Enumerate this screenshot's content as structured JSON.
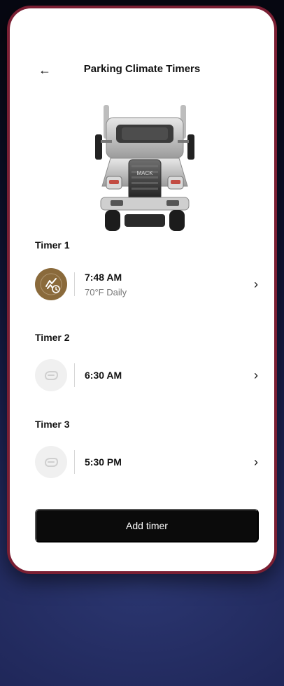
{
  "header": {
    "title": "Parking Climate Timers",
    "back_icon": "←"
  },
  "truck": {
    "brand_text": "MACK"
  },
  "timers": [
    {
      "label": "Timer 1",
      "time": "7:48 AM",
      "sub": "70°F Daily",
      "state": "active"
    },
    {
      "label": "Timer 2",
      "time": "6:30 AM",
      "sub": "",
      "state": "inactive"
    },
    {
      "label": "Timer 3",
      "time": "5:30 PM",
      "sub": "",
      "state": "inactive"
    }
  ],
  "actions": {
    "add_timer_label": "Add timer"
  },
  "colors": {
    "active_badge": "#8a6a3b",
    "inactive_badge": "#f0f0f0",
    "phone_frame": "#7a1f33"
  },
  "icons": {
    "chevron": "›"
  }
}
